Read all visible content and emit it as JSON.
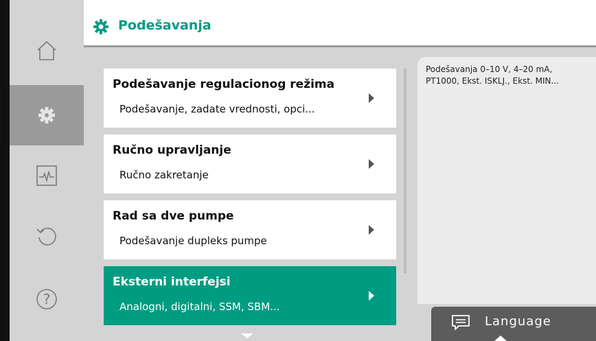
{
  "header": {
    "title": "Podešavanja",
    "icon": "gear-icon",
    "accent": "#009c82"
  },
  "sidebar": {
    "items": [
      {
        "name": "home",
        "icon": "home-icon",
        "active": false
      },
      {
        "name": "settings",
        "icon": "gear-icon",
        "active": true
      },
      {
        "name": "diagnostics",
        "icon": "pulse-icon",
        "active": false
      },
      {
        "name": "restore",
        "icon": "restore-icon",
        "active": false
      },
      {
        "name": "help",
        "icon": "help-icon",
        "active": false
      }
    ]
  },
  "menu": {
    "items": [
      {
        "title": "Podešavanje regulacionog režima",
        "subtitle": "Podešavanje, zadate vrednosti, opci...",
        "selected": false
      },
      {
        "title": "Ručno upravljanje",
        "subtitle": "Ručno zakretanje",
        "selected": false
      },
      {
        "title": "Rad sa dve pumpe",
        "subtitle": "Podešavanje dupleks pumpe",
        "selected": false
      },
      {
        "title": "Eksterni interfejsi",
        "subtitle": "Analogni, digitalni, SSM, SBM...",
        "selected": true
      }
    ]
  },
  "info": {
    "text": "Podešavanja 0–10 V, 4–20 mA, PT1000, Ekst. ISKLJ., Ekst. MIN..."
  },
  "language": {
    "label": "Language",
    "icon": "chat-icon"
  }
}
